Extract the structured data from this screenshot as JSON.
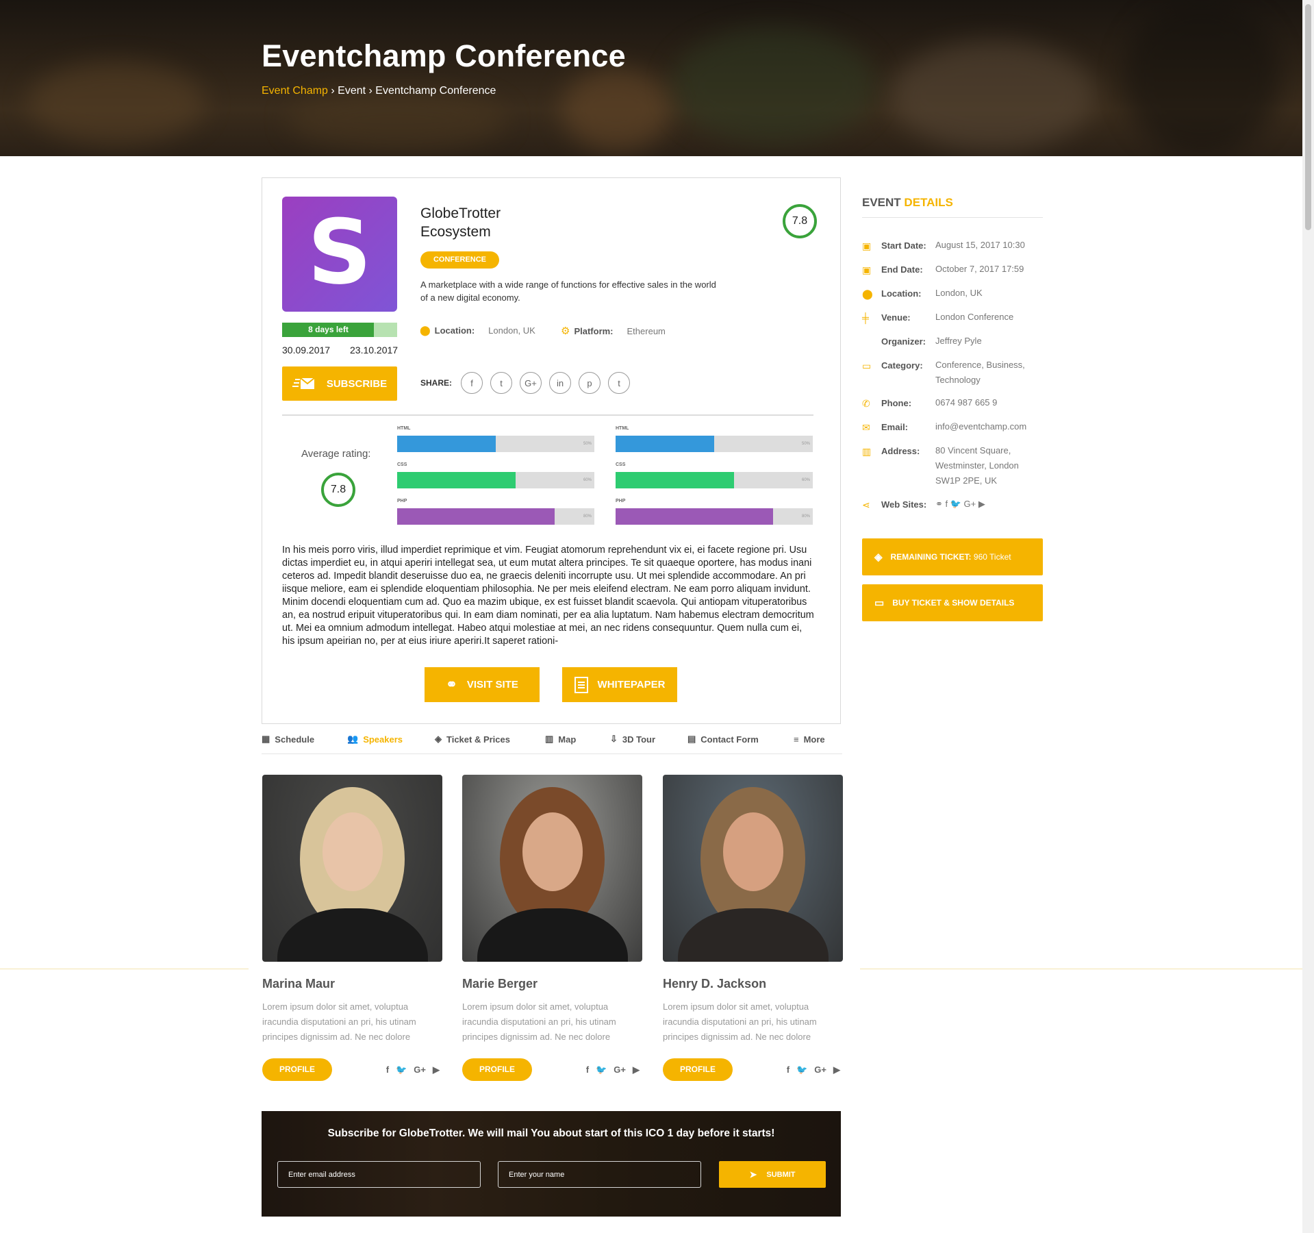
{
  "hero": {
    "title": "Eventchamp Conference",
    "breadcrumb": {
      "home": "Event Champ",
      "sep1": " › ",
      "section": "Event",
      "sep2": " › ",
      "current": "Eventchamp Conference"
    }
  },
  "project": {
    "logo_letter": "S",
    "days_left": "8 days left",
    "days_progress": 0.8,
    "start_date": "30.09.2017",
    "end_date": "23.10.2017",
    "subscribe_label": "SUBSCRIBE",
    "name": "GlobeTrotter Ecosystem",
    "tag": "CONFERENCE",
    "description": "A marketplace with a wide range of functions for effective sales in the world of a new digital economy.",
    "rating": "7.8",
    "location_label": "Location:",
    "location_value": "London, UK",
    "platform_label": "Platform:",
    "platform_value": "Ethereum",
    "share_label": "SHARE:",
    "share_icons": [
      "f",
      "t",
      "G+",
      "in",
      "p",
      "t"
    ],
    "average_rating_label": "Average rating:",
    "average_rating": "7.8",
    "bars_left": [
      {
        "label": "HTML",
        "value": 0.5,
        "pct": "50%",
        "color": "#3498db"
      },
      {
        "label": "CSS",
        "value": 0.6,
        "pct": "60%",
        "color": "#2ecc71"
      },
      {
        "label": "PHP",
        "value": 0.8,
        "pct": "80%",
        "color": "#9b59b6"
      }
    ],
    "bars_right": [
      {
        "label": "HTML",
        "value": 0.5,
        "pct": "50%",
        "color": "#3498db"
      },
      {
        "label": "CSS",
        "value": 0.6,
        "pct": "60%",
        "color": "#2ecc71"
      },
      {
        "label": "PHP",
        "value": 0.8,
        "pct": "80%",
        "color": "#9b59b6"
      }
    ],
    "body": "In his meis porro viris, illud imperdiet reprimique et vim. Feugiat atomorum reprehendunt vix ei, ei facete regione pri. Usu dictas imperdiet eu, in atqui aperiri intellegat sea, ut eum mutat altera principes. Te sit quaeque oportere, has modus inani ceteros ad. Impedit blandit deseruisse duo ea, ne graecis deleniti incorrupte usu. Ut mei splendide accommodare. An pri iisque meliore, eam ei splendide eloquentiam philosophia. Ne per meis eleifend electram. Ne eam porro aliquam invidunt. Minim docendi eloquentiam cum ad. Quo ea mazim ubique, ex est fuisset blandit scaevola. Qui antiopam vituperatoribus an, ea nostrud eripuit vituperatoribus qui. In eam diam nominati, per ea alia luptatum. Nam habemus electram democritum ut. Mei ea omnium admodum intellegat. Habeo atqui molestiae at mei, an nec ridens consequuntur. Quem nulla cum ei, his ipsum apeirian no, per at eius iriure aperiri.It saperet rationi-",
    "visit_label": "VISIT SITE",
    "whitepaper_label": "WHITEPAPER"
  },
  "tabs": [
    {
      "label": "Schedule",
      "icon": "calendar-icon",
      "glyph": "▦"
    },
    {
      "label": "Speakers",
      "icon": "users-icon",
      "glyph": "👥"
    },
    {
      "label": "Ticket & Prices",
      "icon": "ticket-icon",
      "glyph": "◈"
    },
    {
      "label": "Map",
      "icon": "map-icon",
      "glyph": "▥"
    },
    {
      "label": "3D Tour",
      "icon": "tour-icon",
      "glyph": "⇩"
    },
    {
      "label": "Contact Form",
      "icon": "form-icon",
      "glyph": "▤"
    },
    {
      "label": "More",
      "icon": "menu-icon",
      "glyph": "≡"
    }
  ],
  "active_tab": "Speakers",
  "sidebar": {
    "title_a": "EVENT",
    "title_b": "DETAILS",
    "rows": [
      {
        "icon": "calendar-check-icon",
        "glyph": "▣",
        "key": "Start Date:",
        "value": "August 15, 2017 10:30"
      },
      {
        "icon": "calendar-x-icon",
        "glyph": "▣",
        "key": "End Date:",
        "value": "October 7, 2017 17:59"
      },
      {
        "icon": "map-pin-icon",
        "glyph": "⬤",
        "key": "Location:",
        "value": "London, UK"
      },
      {
        "icon": "signpost-icon",
        "glyph": "╪",
        "key": "Venue:",
        "value": "London Conference"
      },
      {
        "icon": "none",
        "glyph": "",
        "key": "Organizer:",
        "value": "Jeffrey Pyle"
      },
      {
        "icon": "folder-icon",
        "glyph": "▭",
        "key": "Category:",
        "value": "Conference, Business, Technology"
      },
      {
        "icon": "phone-icon",
        "glyph": "✆",
        "key": "Phone:",
        "value": "0674 987 665 9"
      },
      {
        "icon": "mail-icon",
        "glyph": "✉",
        "key": "Email:",
        "value": "info@eventchamp.com"
      },
      {
        "icon": "map-icon",
        "glyph": "▥",
        "key": "Address:",
        "value": "80 Vincent Square, Westminster, London SW1P 2PE, UK"
      },
      {
        "icon": "share-icon",
        "glyph": "⋖",
        "key": "Web Sites:",
        "value": "⚭  f  🐦  G+  ▶"
      }
    ],
    "remaining_label": "REMAINING TICKET:",
    "remaining_value": "960 Ticket",
    "buy_label": "BUY TICKET & SHOW DETAILS"
  },
  "speakers": [
    {
      "name": "Marina Maur",
      "bio": "Lorem ipsum dolor sit amet, voluptua iracundia disputationi an pri, his utinam principes dignissim ad. Ne nec dolore",
      "profile": "PROFILE",
      "hair": "#d8c49a",
      "bg": "#4a4a48",
      "skin": "#e8c4a8",
      "shirt": "#1a1a1a"
    },
    {
      "name": "Marie Berger",
      "bio": "Lorem ipsum dolor sit amet, voluptua iracundia disputationi an pri, his utinam principes dignissim ad. Ne nec dolore",
      "profile": "PROFILE",
      "hair": "#7a4a2a",
      "bg": "#9a9a96",
      "skin": "#d9a888",
      "shirt": "#181818"
    },
    {
      "name": "Henry D. Jackson",
      "bio": "Lorem ipsum dolor sit amet, voluptua iracundia disputationi an pri, his utinam principes dignissim ad. Ne nec dolore",
      "profile": "PROFILE",
      "hair": "#8a6a48",
      "bg": "#5d6a74",
      "skin": "#d6a080",
      "shirt": "#2a2624"
    }
  ],
  "speaker_social": [
    "f",
    "🐦",
    "G+",
    "▶"
  ],
  "newsletter": {
    "title": "Subscribe for GlobeTrotter.  We will mail You about start of this ICO  1 day before it starts!",
    "email_placeholder": "Enter email address",
    "name_placeholder": "Enter your name",
    "submit_label": "SUBMIT"
  },
  "colors": {
    "accent": "#f5b400",
    "rating_green": "#3aa33b"
  }
}
